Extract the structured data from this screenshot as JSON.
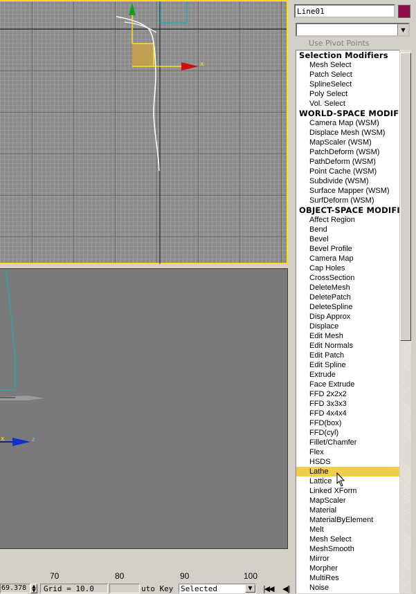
{
  "object_name": "Line01",
  "object_color": "#8c0f4b",
  "modifier_combo": {
    "value": ""
  },
  "use_pivot_points": "Use Pivot Points",
  "modifier_list": [
    {
      "label": "Selection Modifiers",
      "type": "header"
    },
    {
      "label": "Mesh Select"
    },
    {
      "label": "Patch Select"
    },
    {
      "label": "SplineSelect"
    },
    {
      "label": "Poly Select"
    },
    {
      "label": "Vol. Select"
    },
    {
      "label": "WORLD-SPACE MODIFIE",
      "type": "header"
    },
    {
      "label": "Camera Map (WSM)"
    },
    {
      "label": "Displace Mesh (WSM)"
    },
    {
      "label": "MapScaler (WSM)"
    },
    {
      "label": "PatchDeform (WSM)"
    },
    {
      "label": "PathDeform (WSM)"
    },
    {
      "label": "Point Cache (WSM)"
    },
    {
      "label": "Subdivide (WSM)"
    },
    {
      "label": "Surface Mapper (WSM)"
    },
    {
      "label": "SurfDeform (WSM)"
    },
    {
      "label": "OBJECT-SPACE MODIFIE",
      "type": "header"
    },
    {
      "label": "Affect Region"
    },
    {
      "label": "Bend"
    },
    {
      "label": "Bevel"
    },
    {
      "label": "Bevel Profile"
    },
    {
      "label": "Camera Map"
    },
    {
      "label": "Cap Holes"
    },
    {
      "label": "CrossSection"
    },
    {
      "label": "DeleteMesh"
    },
    {
      "label": "DeletePatch"
    },
    {
      "label": "DeleteSpline"
    },
    {
      "label": "Disp Approx"
    },
    {
      "label": "Displace"
    },
    {
      "label": "Edit Mesh"
    },
    {
      "label": "Edit Normals"
    },
    {
      "label": "Edit Patch"
    },
    {
      "label": "Edit Spline"
    },
    {
      "label": "Extrude"
    },
    {
      "label": "Face Extrude"
    },
    {
      "label": "FFD 2x2x2"
    },
    {
      "label": "FFD 3x3x3"
    },
    {
      "label": "FFD 4x4x4"
    },
    {
      "label": "FFD(box)"
    },
    {
      "label": "FFD(cyl)"
    },
    {
      "label": "Fillet/Chamfer"
    },
    {
      "label": "Flex"
    },
    {
      "label": "HSDS"
    },
    {
      "label": "Lathe",
      "selected": true
    },
    {
      "label": "Lattice"
    },
    {
      "label": "Linked XForm"
    },
    {
      "label": "MapScaler"
    },
    {
      "label": "Material"
    },
    {
      "label": "MaterialByElement"
    },
    {
      "label": "Melt"
    },
    {
      "label": "Mesh Select"
    },
    {
      "label": "MeshSmooth"
    },
    {
      "label": "Mirror"
    },
    {
      "label": "Morpher"
    },
    {
      "label": "MultiRes"
    },
    {
      "label": "Noise"
    }
  ],
  "ruler": {
    "ticks": [
      "70",
      "80",
      "90",
      "100"
    ]
  },
  "status": {
    "coord_value": "69.378",
    "grid": "Grid = 10.0",
    "auto_key": "uto Key",
    "selected": "Selected"
  },
  "viewport_top": {
    "axis_x_label": "x"
  },
  "viewport_bottom": {
    "axis_x_label": "x",
    "axis_z_label": "z"
  }
}
